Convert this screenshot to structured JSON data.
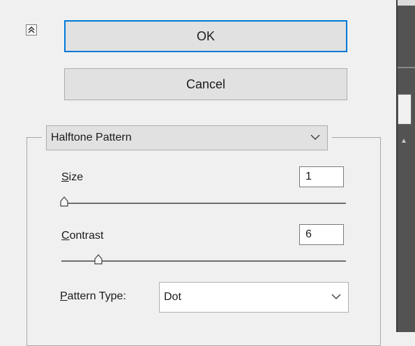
{
  "buttons": {
    "ok_label": "OK",
    "cancel_label": "Cancel"
  },
  "filter_group": {
    "mode_value": "Halftone Pattern"
  },
  "size": {
    "label_mnemonic": "S",
    "label_rest": "ize",
    "value": "1",
    "slider_level": 0.0
  },
  "contrast": {
    "label_mnemonic": "C",
    "label_rest": "ontrast",
    "value": "6",
    "slider_level": 0.12
  },
  "pattern_type": {
    "label_mnemonic": "P",
    "label_rest": "attern Type:",
    "value": "Dot"
  },
  "icons": {
    "collapse": "collapse-up-icon",
    "dropdown": "chevron-down-icon",
    "slider_thumb": "slider-thumb-icon"
  },
  "colors": {
    "focus_border": "#0078d7",
    "dialog_bg": "#f0f0f0",
    "panel_bg": "#535353"
  }
}
